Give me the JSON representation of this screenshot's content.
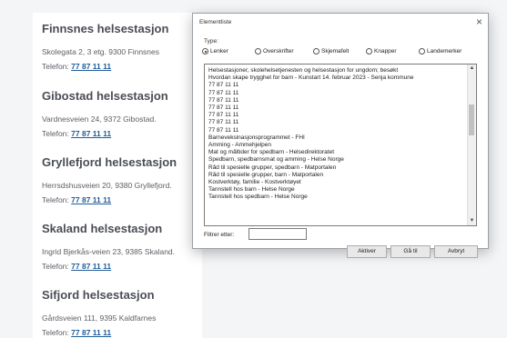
{
  "stations": [
    {
      "name": "Finnsnes helsestasjon",
      "address": "Skolegata 2, 3 etg. 9300 Finnsnes",
      "phone_label": "Telefon:",
      "phone": "77 87 11 11"
    },
    {
      "name": "Gibostad helsestasjon",
      "address": "Vardnesveien 24, 9372 Gibostad.",
      "phone_label": "Telefon:",
      "phone": "77 87 11 11"
    },
    {
      "name": "Gryllefjord helsestasjon",
      "address": "Herrsdshusveien 20, 9380 Gryllefjord.",
      "phone_label": "Telefon:",
      "phone": "77 87 11 11"
    },
    {
      "name": "Skaland helsestasjon",
      "address": "Ingrid Bjerkås-veien 23, 9385 Skaland.",
      "phone_label": "Telefon:",
      "phone": "77 87 11 11"
    },
    {
      "name": "Sifjord helsestasjon",
      "address": "Gårdsveien 111, 9395 Kaldfarnes",
      "phone_label": "Telefon:",
      "phone": "77 87 11 11"
    }
  ],
  "dialog": {
    "title": "Elementliste",
    "close_glyph": "×",
    "type_label": "Type:",
    "radios": [
      {
        "label": "Lenker",
        "checked": true
      },
      {
        "label": "Overskrifter",
        "checked": false
      },
      {
        "label": "Skjemafelt",
        "checked": false
      },
      {
        "label": "Knapper",
        "checked": false
      },
      {
        "label": "Landemerker",
        "checked": false
      }
    ],
    "items": [
      "Helsestasjoner, skolehelsetjenesten og helsestasjon for ungdom; besøkt",
      "Hvordan skape trygghet for barn - Kunstart 14. februar 2023 - Senja kommune",
      "77 87 11 11",
      "77 87 11 11",
      "77 87 11 11",
      "77 87 11 11",
      "77 87 11 11",
      "77 87 11 11",
      "77 87 11 11",
      "Barneveksinasjonsprogrammet - FHI",
      "Amming - Ammehjelpen",
      "Mat og måltider for spedbarn - Helsedirektoratet",
      "Spedbarn, spedbarnsmat og amming - Helse Norge",
      "Råd til spesielle grupper, spedbarn - Matportalen",
      "Råd til spesielle grupper, barn - Matportalen",
      "Kostverktøy, familie - Kostverktøyet",
      "Tannstell hos barn - Helse Norge",
      "Tannstell hos spedbarn - Helse Norge"
    ],
    "filter_label": "Filtrer etter:",
    "filter_value": "",
    "buttons": {
      "activate": "Aktiver",
      "goto": "Gå til",
      "cancel": "Avbryt"
    }
  }
}
